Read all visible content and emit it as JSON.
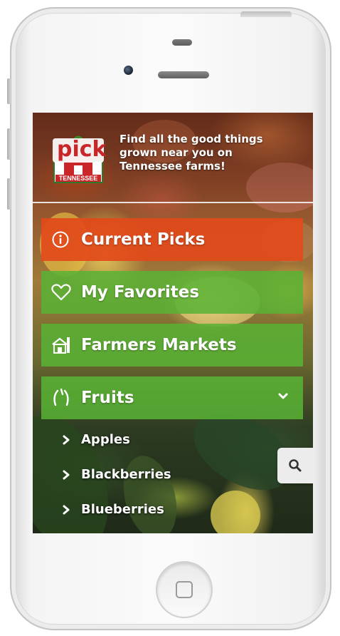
{
  "app": {
    "logo_text": "pick",
    "logo_subtext": "TENNESSEE",
    "tagline": "Find all the good things\ngrown near you on\nTennessee farms!"
  },
  "menu": [
    {
      "label": "Current Picks",
      "icon": "info-icon",
      "color": "#e24a1a"
    },
    {
      "label": "My Favorites",
      "icon": "heart-icon",
      "color": "#58b234"
    },
    {
      "label": "Farmers Markets",
      "icon": "market-icon",
      "color": "#58b234"
    },
    {
      "label": "Fruits",
      "icon": "fruit-icon",
      "color": "#58b234",
      "expanded": true
    }
  ],
  "fruits_submenu": [
    "Apples",
    "Blackberries",
    "Blueberries"
  ],
  "search": {
    "icon": "search-icon"
  }
}
